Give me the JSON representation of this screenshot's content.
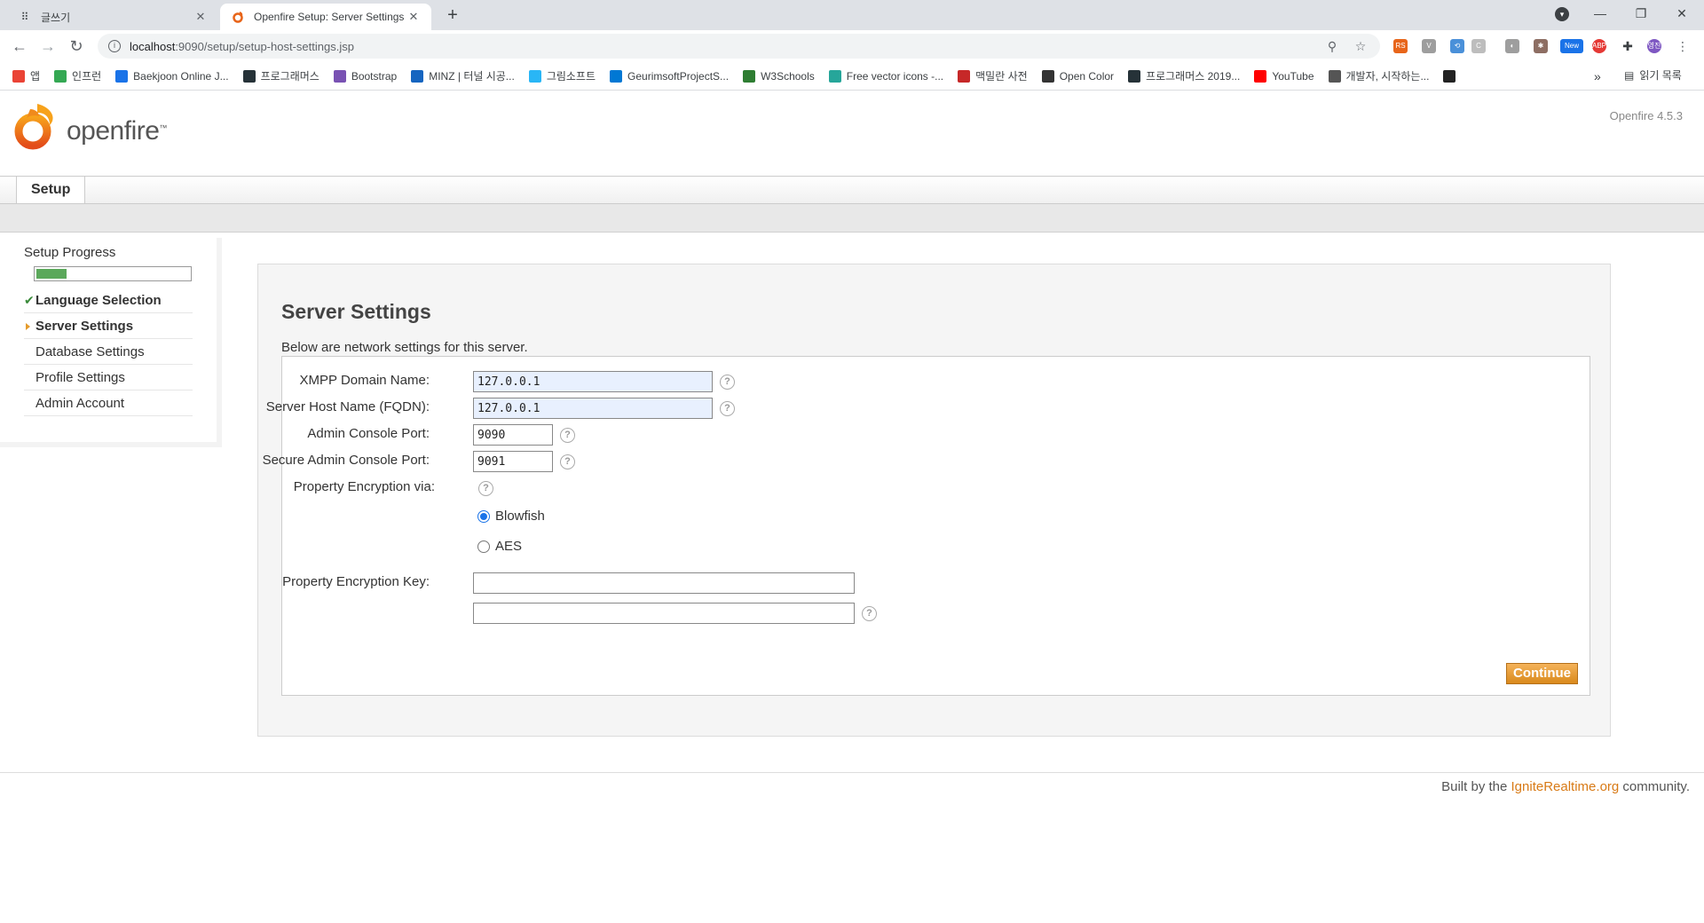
{
  "browser": {
    "tabs": [
      {
        "title": "글쓰기",
        "active": false
      },
      {
        "title": "Openfire Setup: Server Settings",
        "active": true
      }
    ],
    "url_host": "localhost",
    "url_rest": ":9090/setup/setup-host-settings.jsp",
    "bookmarks": [
      {
        "label": "앱",
        "color": "#ea4335"
      },
      {
        "label": "인프런",
        "color": "#34a853"
      },
      {
        "label": "Baekjoon Online J...",
        "color": "#1a73e8"
      },
      {
        "label": "프로그래머스",
        "color": "#263238"
      },
      {
        "label": "Bootstrap",
        "color": "#7952b3"
      },
      {
        "label": "MINZ | 터널 시공...",
        "color": "#1565c0"
      },
      {
        "label": "그림소프트",
        "color": "#29b6f6"
      },
      {
        "label": "GeurimsoftProjectS...",
        "color": "#0078d4"
      },
      {
        "label": "W3Schools",
        "color": "#2e7d32"
      },
      {
        "label": "Free vector icons -...",
        "color": "#26a69a"
      },
      {
        "label": "맥밀란 사전",
        "color": "#c62828"
      },
      {
        "label": "Open Color",
        "color": "#333333"
      },
      {
        "label": "프로그래머스 2019...",
        "color": "#263238"
      },
      {
        "label": "YouTube",
        "color": "#ff0000"
      },
      {
        "label": "개발자, 시작하는...",
        "color": "#555555"
      },
      {
        "label": "",
        "color": "#222222"
      }
    ],
    "reading_list": "읽기 목록",
    "ext_new_badge": "New",
    "ext_abp_badge": "ABP",
    "profile_initials": "영진"
  },
  "header": {
    "logo_text": "openfire",
    "version": "Openfire 4.5.3"
  },
  "nav": {
    "tab_label": "Setup"
  },
  "sidebar": {
    "title": "Setup Progress",
    "progress_fraction": 0.2,
    "items": [
      {
        "label": "Language Selection",
        "state": "done"
      },
      {
        "label": "Server Settings",
        "state": "current"
      },
      {
        "label": "Database Settings",
        "state": "pending"
      },
      {
        "label": "Profile Settings",
        "state": "pending"
      },
      {
        "label": "Admin Account",
        "state": "pending"
      }
    ]
  },
  "content": {
    "title": "Server Settings",
    "description": "Below are network settings for this server.",
    "fields": {
      "xmpp_domain": {
        "label": "XMPP Domain Name:",
        "value": "127.0.0.1"
      },
      "host_name": {
        "label": "Server Host Name (FQDN):",
        "value": "127.0.0.1"
      },
      "admin_port": {
        "label": "Admin Console Port:",
        "value": "9090"
      },
      "secure_admin_port": {
        "label": "Secure Admin Console Port:",
        "value": "9091"
      },
      "encryption_via": {
        "label": "Property Encryption via:"
      },
      "encryption_key": {
        "label": "Property Encryption Key:",
        "value": "",
        "confirm_value": ""
      }
    },
    "encryption_options": [
      {
        "label": "Blowfish",
        "selected": true
      },
      {
        "label": "AES",
        "selected": false
      }
    ],
    "continue_label": "Continue"
  },
  "footer": {
    "prefix": "Built by the ",
    "link": "IgniteRealtime.org",
    "suffix": " community."
  }
}
